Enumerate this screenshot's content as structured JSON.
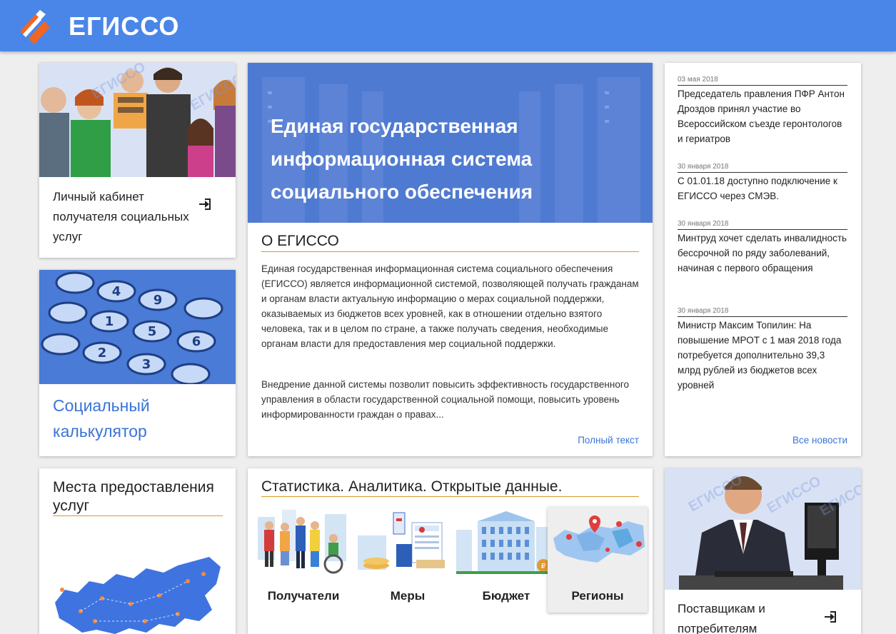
{
  "header": {
    "logo_text": "ЕГИССО"
  },
  "cabinet": {
    "title": "Личный кабинет получателя социальных услуг",
    "watermark": "ЕГИССО"
  },
  "calculator": {
    "title": "Социальный калькулятор"
  },
  "about": {
    "hero_title": "Единая государственная информационная система социального обеспечения",
    "section_title": "О ЕГИССО",
    "paragraph1": "Единая государственная информационная система социального обеспечения (ЕГИССО) является информационной системой, позволяющей получать гражданам и органам власти актуальную информацию о мерах социальной поддержки, оказываемых из бюджетов всех уровней, как в отношении отдельно взятого человека, так и в целом по стране, а также получать сведения, необходимые органам власти для предоставления мер социальной поддержки.",
    "paragraph2": "Внедрение данной системы позволит повысить эффективность государственного управления в области государственной социальной помощи, повысить уровень информированности граждан о правах...",
    "more_link": "Полный текст"
  },
  "news": {
    "items": [
      {
        "date": "03 мая 2018",
        "text": "Председатель правления ПФР Антон Дроздов принял участие во Всероссийском съезде геронтологов и гериатров"
      },
      {
        "date": "30 января 2018",
        "text": "С 01.01.18 доступно подключение к ЕГИССО через СМЭВ."
      },
      {
        "date": "30 января 2018",
        "text": "Минтруд хочет сделать инвалидность бессрочной по ряду заболеваний, начиная с первого обращения"
      },
      {
        "date": "30 января 2018",
        "text": "Министр Максим Топилин: На повышение МРОТ с 1 мая 2018 года потребуется дополнительно 39,3 млрд рублей из бюджетов всех уровней"
      }
    ],
    "all_link": "Все новости"
  },
  "places": {
    "title": "Места предоставления услуг"
  },
  "stats": {
    "title": "Статистика. Аналитика. Открытые данные.",
    "tiles": [
      {
        "label": "Получатели"
      },
      {
        "label": "Меры"
      },
      {
        "label": "Бюджет"
      },
      {
        "label": "Регионы"
      }
    ]
  },
  "suppliers": {
    "title": "Поставщикам и потребителям",
    "watermark": "ЕГИССО"
  },
  "colors": {
    "header": "#4a86e8",
    "accent": "#3a74d6",
    "underline": "#d39b2a"
  }
}
